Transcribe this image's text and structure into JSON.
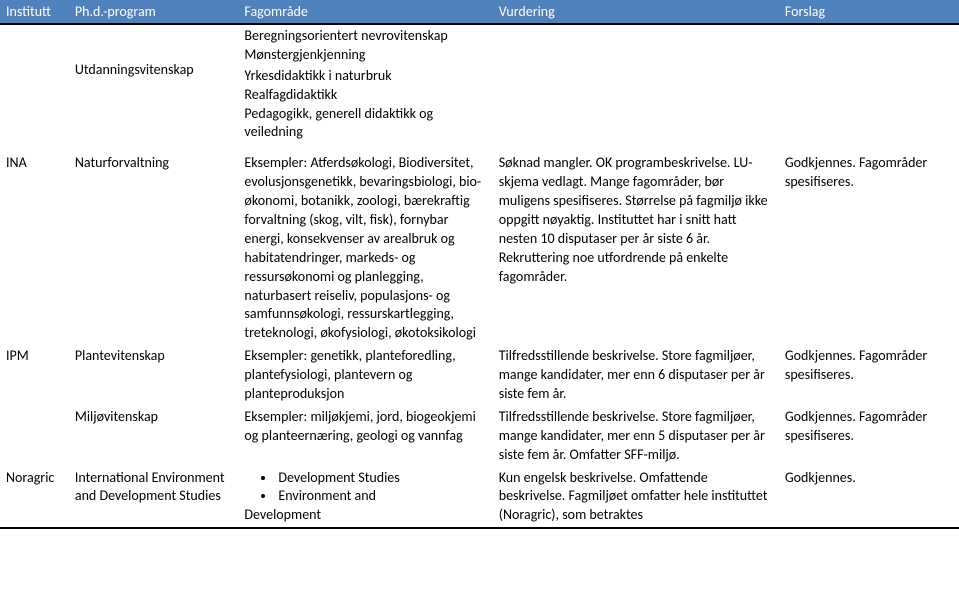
{
  "header": {
    "institutt": "Institutt",
    "program": "Ph.d.-program",
    "fagomrade": "Fagområde",
    "vurdering": "Vurdering",
    "forslag": "Forslag"
  },
  "rows": [
    {
      "institutt": "",
      "program": "Utdanningsvitenskap",
      "fagomrade_highlight": "Beregningsorientert nevrovitenskap\nMønstergjenkjenning",
      "fagomrade_rest": "Yrkesdidaktikk i naturbruk\nRealfagdidaktikk\nPedagogikk, generell didaktikk og veiledning",
      "vurdering": "",
      "forslag": ""
    },
    {
      "institutt": "INA",
      "program": "Naturforvaltning",
      "fagomrade": "Eksempler: Atferdsøkologi, Biodiversitet, evolusjonsgenetikk, bevaringsbiologi, bio-økonomi, botanikk, zoologi, bærekraftig forvaltning (skog, vilt, fisk), fornybar energi, konsekvenser av arealbruk og habitatendringer, markeds- og ressursøkonomi og planlegging, naturbasert reiseliv, populasjons- og samfunnsøkologi, ressurskartlegging, treteknologi, økofysiologi, økotoksikologi",
      "vurdering": "Søknad mangler. OK programbeskrivelse. LU-skjema vedlagt. Mange fagområder, bør muligens spesifiseres. Størrelse på fagmiljø ikke oppgitt nøyaktig. Instituttet har i snitt hatt nesten 10 disputaser per år siste 6 år. Rekruttering noe utfordrende på enkelte fagområder.",
      "forslag": "Godkjennes. Fagområder spesifiseres."
    },
    {
      "institutt": "IPM",
      "program": "Plantevitenskap",
      "fagomrade": "Eksempler: genetikk, planteforedling, plantefysiologi, plantevern og planteproduksjon",
      "vurdering": "Tilfredsstillende beskrivelse. Store fagmiljøer, mange kandidater, mer enn 6 disputaser per år siste fem år.",
      "forslag": "Godkjennes. Fagområder spesifiseres."
    },
    {
      "institutt": "",
      "program": "Miljøvitenskap",
      "fagomrade": "Eksempler: miljøkjemi, jord, biogeokjemi og planteernæring, geologi og vannfag",
      "vurdering": "Tilfredsstillende beskrivelse. Store fagmiljøer, mange kandidater, mer enn 5 disputaser per år siste fem år. Omfatter SFF-miljø.",
      "forslag": "Godkjennes. Fagområder spesifiseres."
    },
    {
      "institutt": "Noragric",
      "program": "International Environment and Development Studies",
      "fagomrade_bullets": [
        "Development Studies",
        "Environment and"
      ],
      "fagomrade_trail": "Development",
      "vurdering": "Kun engelsk beskrivelse. Omfattende beskrivelse. Fagmiljøet omfatter hele instituttet (Noragric), som betraktes",
      "forslag": "Godkjennes."
    }
  ]
}
